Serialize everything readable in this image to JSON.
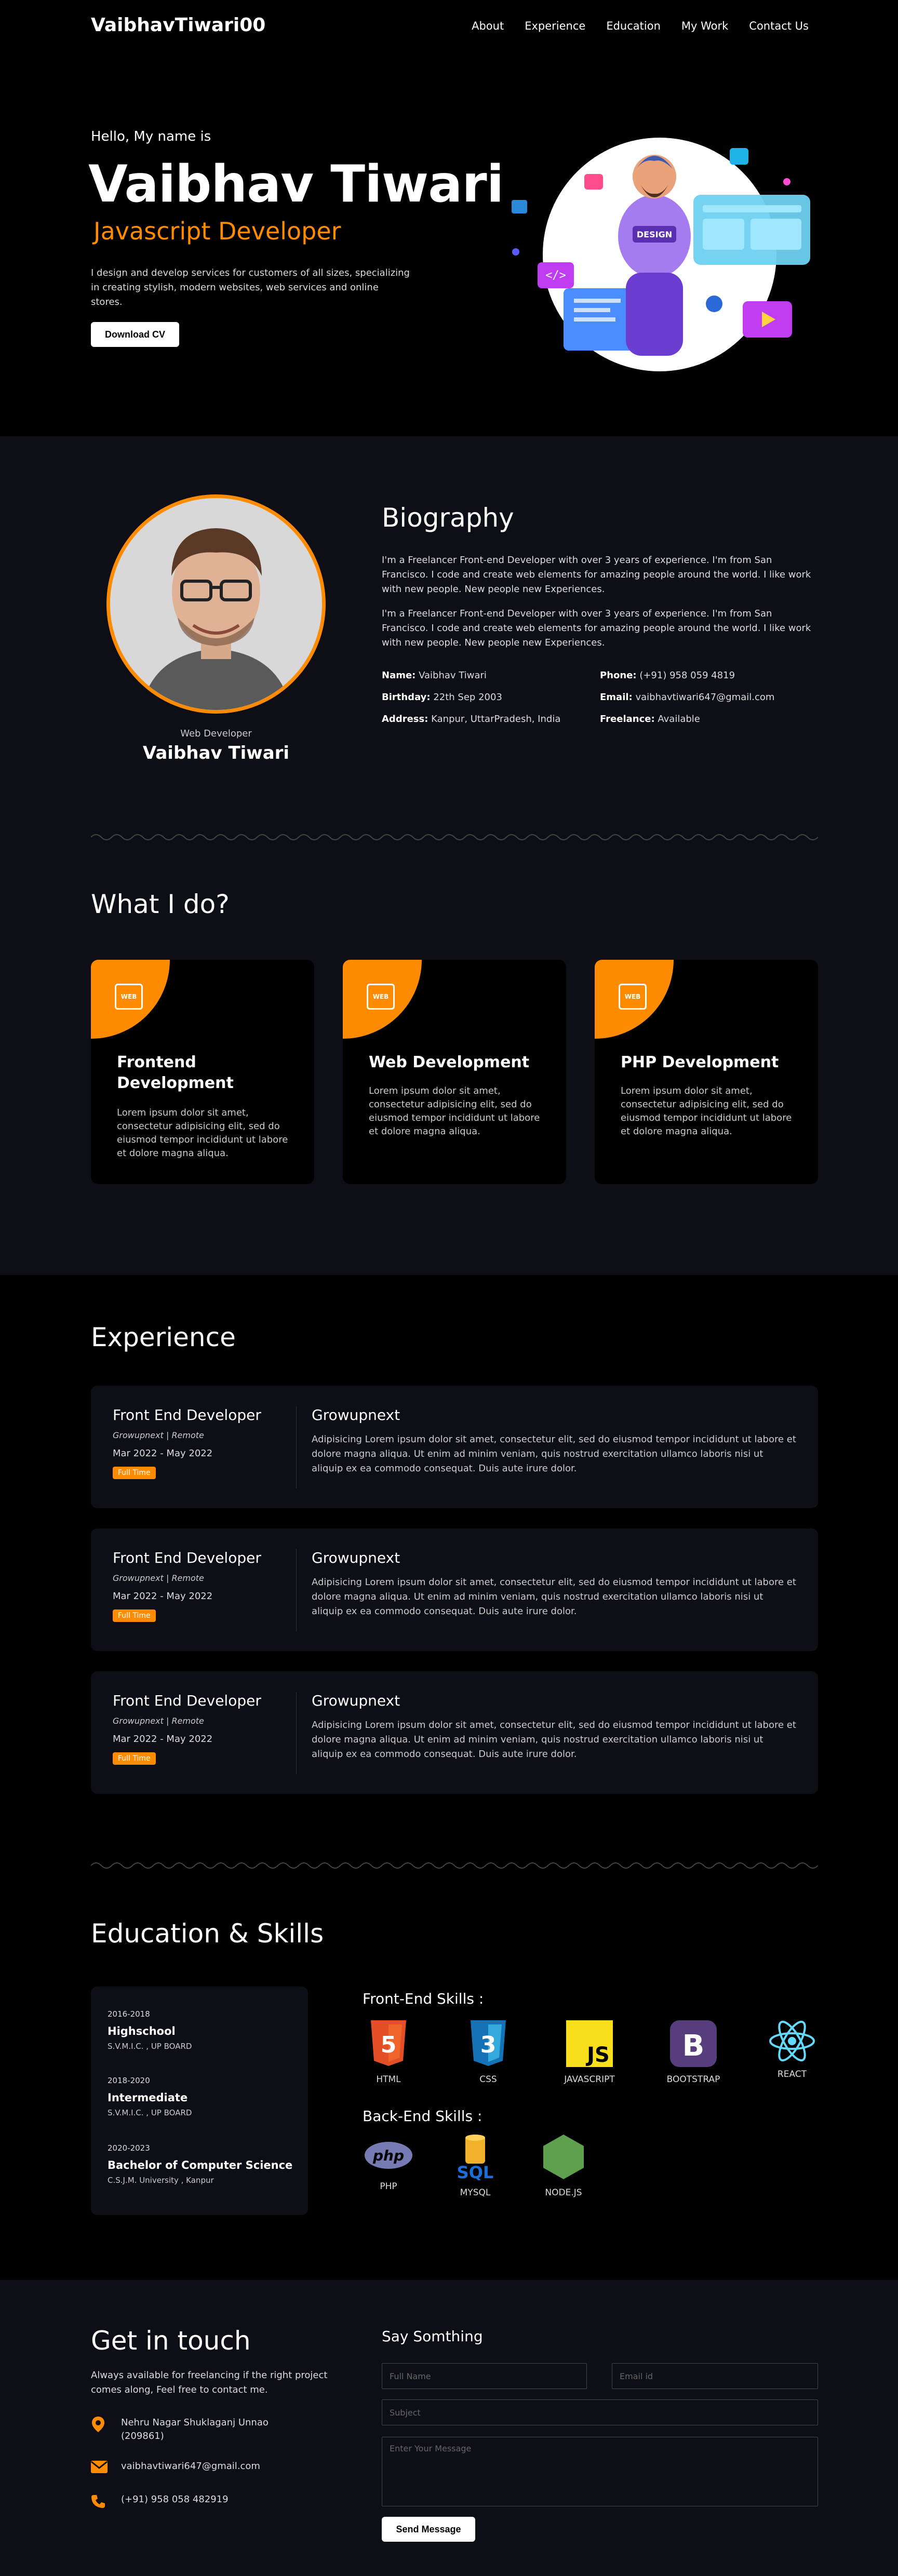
{
  "nav": {
    "brand": "VaibhavTiwari00",
    "links": [
      "About",
      "Experience",
      "Education",
      "My Work",
      "Contact Us"
    ]
  },
  "hero": {
    "greeting": "Hello, My name is",
    "name": "Vaibhav Tiwari",
    "role": "Javascript Developer",
    "description": "I design and develop services for customers of all sizes, specializing in creating stylish, modern websites, web services and online stores.",
    "cta": "Download CV",
    "illustration_sign": "DESIGN"
  },
  "bio": {
    "avatar_role": "Web Developer",
    "avatar_name": "Vaibhav Tiwari",
    "title": "Biography",
    "paragraphs": [
      "I'm a Freelancer Front-end Developer with over 3 years of experience. I'm from San Francisco. I code and create web elements for amazing people around the world. I like work with new people. New people new Experiences.",
      "I'm a Freelancer Front-end Developer with over 3 years of experience. I'm from San Francisco. I code and create web elements for amazing people around the world. I like work with new people. New people new Experiences."
    ],
    "info": [
      {
        "label": "Name:",
        "value": "Vaibhav Tiwari"
      },
      {
        "label": "Phone:",
        "value": "(+91) 958 059 4819"
      },
      {
        "label": "Birthday:",
        "value": "22th Sep 2003"
      },
      {
        "label": "Email:",
        "value": "vaibhavtiwari647@gmail.com"
      },
      {
        "label": "Address:",
        "value": "Kanpur, UttarPradesh, India"
      },
      {
        "label": "Freelance:",
        "value": "Available"
      }
    ]
  },
  "services": {
    "title": "What I do?",
    "icon_text": "WEB",
    "items": [
      {
        "title": "Frontend Development",
        "text": "Lorem ipsum dolor sit amet, consectetur adipisicing elit, sed do eiusmod tempor incididunt ut labore et dolore magna aliqua."
      },
      {
        "title": "Web Development",
        "text": "Lorem ipsum dolor sit amet, consectetur adipisicing elit, sed do eiusmod tempor incididunt ut labore et dolore magna aliqua."
      },
      {
        "title": "PHP Development",
        "text": "Lorem ipsum dolor sit amet, consectetur adipisicing elit, sed do eiusmod tempor incididunt ut labore et dolore magna aliqua."
      }
    ]
  },
  "experience": {
    "title": "Experience",
    "items": [
      {
        "role": "Front End Developer",
        "company": "Growupnext | Remote",
        "dates": "Mar 2022 - May 2022",
        "badge": "Full Time",
        "org": "Growupnext",
        "desc": "Adipisicing Lorem ipsum dolor sit amet, consectetur elit, sed do eiusmod tempor incididunt ut labore et dolore magna aliqua. Ut enim ad minim veniam, quis nostrud exercitation ullamco laboris nisi ut aliquip ex ea commodo consequat. Duis aute irure dolor."
      },
      {
        "role": "Front End Developer",
        "company": "Growupnext | Remote",
        "dates": "Mar 2022 - May 2022",
        "badge": "Full Time",
        "org": "Growupnext",
        "desc": "Adipisicing Lorem ipsum dolor sit amet, consectetur elit, sed do eiusmod tempor incididunt ut labore et dolore magna aliqua. Ut enim ad minim veniam, quis nostrud exercitation ullamco laboris nisi ut aliquip ex ea commodo consequat. Duis aute irure dolor."
      },
      {
        "role": "Front End Developer",
        "company": "Growupnext | Remote",
        "dates": "Mar 2022 - May 2022",
        "badge": "Full Time",
        "org": "Growupnext",
        "desc": "Adipisicing Lorem ipsum dolor sit amet, consectetur elit, sed do eiusmod tempor incididunt ut labore et dolore magna aliqua. Ut enim ad minim veniam, quis nostrud exercitation ullamco laboris nisi ut aliquip ex ea commodo consequat. Duis aute irure dolor."
      }
    ]
  },
  "education": {
    "title": "Education & Skills",
    "items": [
      {
        "years": "2016-2018",
        "degree": "Highschool",
        "school": "S.V.M.I.C. , UP BOARD"
      },
      {
        "years": "2018-2020",
        "degree": "Intermediate",
        "school": "S.V.M.I.C. , UP BOARD"
      },
      {
        "years": "2020-2023",
        "degree": "Bachelor of Computer Science",
        "school": "C.S.J.M. University , Kanpur"
      }
    ],
    "frontend_title": "Front-End Skills :",
    "frontend": [
      "HTML",
      "CSS",
      "JAVASCRIPT",
      "BOOTSTRAP",
      "REACT"
    ],
    "backend_title": "Back-End Skills :",
    "backend": [
      "PHP",
      "MYSQL",
      "NODE.JS"
    ],
    "logo_text": {
      "html": "5",
      "css": "3",
      "js": "JS",
      "bootstrap": "B",
      "php": "php",
      "mysql": "SQL"
    }
  },
  "contact": {
    "title": "Get in touch",
    "subtitle": "Always available for freelancing if the right project comes along, Feel free to contact me.",
    "address": "Nehru Nagar Shuklaganj Unnao (209861)",
    "email": "vaibhavtiwari647@gmail.com",
    "phone": "(+91) 958 058 482919",
    "form_title": "Say Somthing",
    "placeholders": {
      "name": "Full Name",
      "email": "Email id",
      "subject": "Subject",
      "message": "Enter Your Message"
    },
    "send": "Send Message"
  },
  "colors": {
    "accent": "#ff8c00",
    "panel": "#0e0e16",
    "background": "#000000"
  }
}
